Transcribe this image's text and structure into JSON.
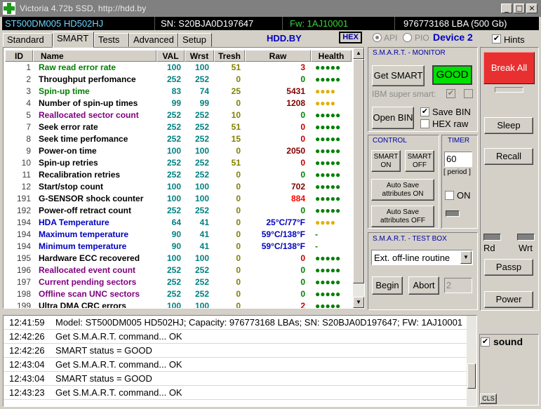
{
  "window": {
    "title": "Victoria 4.72b SSD, http://hdd.by"
  },
  "infobar": {
    "model": "ST500DM005 HD502HJ",
    "serial": "SN: S20BJA0D197647",
    "firmware": "Fw: 1AJ10001",
    "capacity": "976773168 LBA (500 Gb)"
  },
  "tabs": [
    "Standard",
    "SMART",
    "Tests",
    "Advanced",
    "Setup"
  ],
  "active_tab": "SMART",
  "header": {
    "site": "HDD.BY",
    "hex_label": "HEX",
    "api_label": "API",
    "pio_label": "PIO",
    "device_label": "Device 2",
    "hints_label": "Hints"
  },
  "table": {
    "columns": [
      "ID",
      "Name",
      "VAL",
      "Wrst",
      "Tresh",
      "Raw",
      "Health"
    ],
    "rows": [
      {
        "id": "1",
        "name": "Raw read error rate",
        "val": "100",
        "wrst": "100",
        "tresh": "51",
        "raw": "3",
        "health": "●●●●●",
        "name_color": "#008000",
        "health_color": "#008000",
        "raw_color": "#c00000"
      },
      {
        "id": "2",
        "name": "Throughput perfomance",
        "val": "252",
        "wrst": "252",
        "tresh": "0",
        "raw": "0",
        "health": "●●●●●",
        "name_color": "#000000",
        "health_color": "#008000",
        "raw_color": "#008000"
      },
      {
        "id": "3",
        "name": "Spin-up time",
        "val": "83",
        "wrst": "74",
        "tresh": "25",
        "raw": "5431",
        "health": "●●●●",
        "name_color": "#008000",
        "health_color": "#e0b000",
        "raw_color": "#800000"
      },
      {
        "id": "4",
        "name": "Number of spin-up times",
        "val": "99",
        "wrst": "99",
        "tresh": "0",
        "raw": "1208",
        "health": "●●●●",
        "name_color": "#000000",
        "health_color": "#e0b000",
        "raw_color": "#800000"
      },
      {
        "id": "5",
        "name": "Reallocated sector count",
        "val": "252",
        "wrst": "252",
        "tresh": "10",
        "raw": "0",
        "health": "●●●●●",
        "name_color": "#800080",
        "health_color": "#008000",
        "raw_color": "#008000"
      },
      {
        "id": "7",
        "name": "Seek error rate",
        "val": "252",
        "wrst": "252",
        "tresh": "51",
        "raw": "0",
        "health": "●●●●●",
        "name_color": "#000000",
        "health_color": "#008000",
        "raw_color": "#c00000"
      },
      {
        "id": "8",
        "name": "Seek time perfomance",
        "val": "252",
        "wrst": "252",
        "tresh": "15",
        "raw": "0",
        "health": "●●●●●",
        "name_color": "#000000",
        "health_color": "#008000",
        "raw_color": "#c00000"
      },
      {
        "id": "9",
        "name": "Power-on time",
        "val": "100",
        "wrst": "100",
        "tresh": "0",
        "raw": "2050",
        "health": "●●●●●",
        "name_color": "#000000",
        "health_color": "#008000",
        "raw_color": "#800000"
      },
      {
        "id": "10",
        "name": "Spin-up retries",
        "val": "252",
        "wrst": "252",
        "tresh": "51",
        "raw": "0",
        "health": "●●●●●",
        "name_color": "#000000",
        "health_color": "#008000",
        "raw_color": "#c00000"
      },
      {
        "id": "11",
        "name": "Recalibration retries",
        "val": "252",
        "wrst": "252",
        "tresh": "0",
        "raw": "0",
        "health": "●●●●●",
        "name_color": "#000000",
        "health_color": "#008000",
        "raw_color": "#008000"
      },
      {
        "id": "12",
        "name": "Start/stop count",
        "val": "100",
        "wrst": "100",
        "tresh": "0",
        "raw": "702",
        "health": "●●●●●",
        "name_color": "#000000",
        "health_color": "#008000",
        "raw_color": "#800000"
      },
      {
        "id": "191",
        "name": "G-SENSOR shock counter",
        "val": "100",
        "wrst": "100",
        "tresh": "0",
        "raw": "884",
        "health": "●●●●●",
        "name_color": "#000000",
        "health_color": "#008000",
        "raw_color": "#ff0000"
      },
      {
        "id": "192",
        "name": "Power-off retract count",
        "val": "252",
        "wrst": "252",
        "tresh": "0",
        "raw": "0",
        "health": "●●●●●",
        "name_color": "#000000",
        "health_color": "#008000",
        "raw_color": "#008000"
      },
      {
        "id": "194",
        "name": "HDA Temperature",
        "val": "64",
        "wrst": "41",
        "tresh": "0",
        "raw": "25°C/77°F",
        "health": "●●●●",
        "name_color": "#0000c0",
        "health_color": "#e0b000",
        "raw_color": "#0000c0"
      },
      {
        "id": "194",
        "name": "Maximum temperature",
        "val": "90",
        "wrst": "41",
        "tresh": "0",
        "raw": "59°C/138°F",
        "health": "-",
        "name_color": "#0000c0",
        "health_color": "#008000",
        "raw_color": "#0000c0"
      },
      {
        "id": "194",
        "name": "Minimum temperature",
        "val": "90",
        "wrst": "41",
        "tresh": "0",
        "raw": "59°C/138°F",
        "health": "-",
        "name_color": "#0000c0",
        "health_color": "#008000",
        "raw_color": "#0000c0"
      },
      {
        "id": "195",
        "name": "Hardware ECC recovered",
        "val": "100",
        "wrst": "100",
        "tresh": "0",
        "raw": "0",
        "health": "●●●●●",
        "name_color": "#000000",
        "health_color": "#008000",
        "raw_color": "#c00000"
      },
      {
        "id": "196",
        "name": "Reallocated event count",
        "val": "252",
        "wrst": "252",
        "tresh": "0",
        "raw": "0",
        "health": "●●●●●",
        "name_color": "#800080",
        "health_color": "#008000",
        "raw_color": "#008000"
      },
      {
        "id": "197",
        "name": "Current pending sectors",
        "val": "252",
        "wrst": "252",
        "tresh": "0",
        "raw": "0",
        "health": "●●●●●",
        "name_color": "#800080",
        "health_color": "#008000",
        "raw_color": "#008000"
      },
      {
        "id": "198",
        "name": "Offline scan UNC sectors",
        "val": "252",
        "wrst": "252",
        "tresh": "0",
        "raw": "0",
        "health": "●●●●●",
        "name_color": "#800080",
        "health_color": "#008000",
        "raw_color": "#008000"
      },
      {
        "id": "199",
        "name": "Ultra DMA CRC errors",
        "val": "100",
        "wrst": "100",
        "tresh": "0",
        "raw": "2",
        "health": "●●●●●",
        "name_color": "#000000",
        "health_color": "#008000",
        "raw_color": "#c00000"
      }
    ]
  },
  "monitor": {
    "title": "S.M.A.R.T. - MONITOR",
    "get_smart": "Get SMART",
    "status": "GOOD",
    "ibm_label": "IBM super smart:",
    "open_bin": "Open BIN",
    "save_bin": "Save BIN",
    "hex_raw": "HEX raw"
  },
  "control": {
    "title": "CONTROL",
    "smart_on": "SMART ON",
    "smart_off": "SMART OFF",
    "autosave_on": "Auto Save attributes ON",
    "autosave_off": "Auto Save attributes OFF"
  },
  "timer": {
    "title": "TIMER",
    "value": "60",
    "period": "[ period ]",
    "on_label": "ON"
  },
  "testbox": {
    "title": "S.M.A.R.T. - TEST BOX",
    "selected": "Ext. off-line routine",
    "begin": "Begin",
    "abort": "Abort",
    "number": "2"
  },
  "right": {
    "break_all": "Break All",
    "sleep": "Sleep",
    "recall": "Recall",
    "rd": "Rd",
    "wrt": "Wrt",
    "passp": "Passp",
    "power": "Power"
  },
  "log": [
    {
      "time": "12:41:59",
      "msg": "Model: ST500DM005 HD502HJ; Capacity: 976773168 LBAs; SN: S20BJA0D197647; FW: 1AJ10001"
    },
    {
      "time": "12:42:26",
      "msg": "Get S.M.A.R.T. command... OK"
    },
    {
      "time": "12:42:26",
      "msg": "SMART status = GOOD"
    },
    {
      "time": "12:43:04",
      "msg": "Get S.M.A.R.T. command... OK"
    },
    {
      "time": "12:43:04",
      "msg": "SMART status = GOOD"
    },
    {
      "time": "12:43:23",
      "msg": "Get S.M.A.R.T. command... OK"
    }
  ],
  "sound": {
    "label": "sound",
    "cls": "CLS"
  },
  "colors": {
    "good": "#00e000",
    "break": "#e83030",
    "accent_blue": "#0000c0"
  }
}
